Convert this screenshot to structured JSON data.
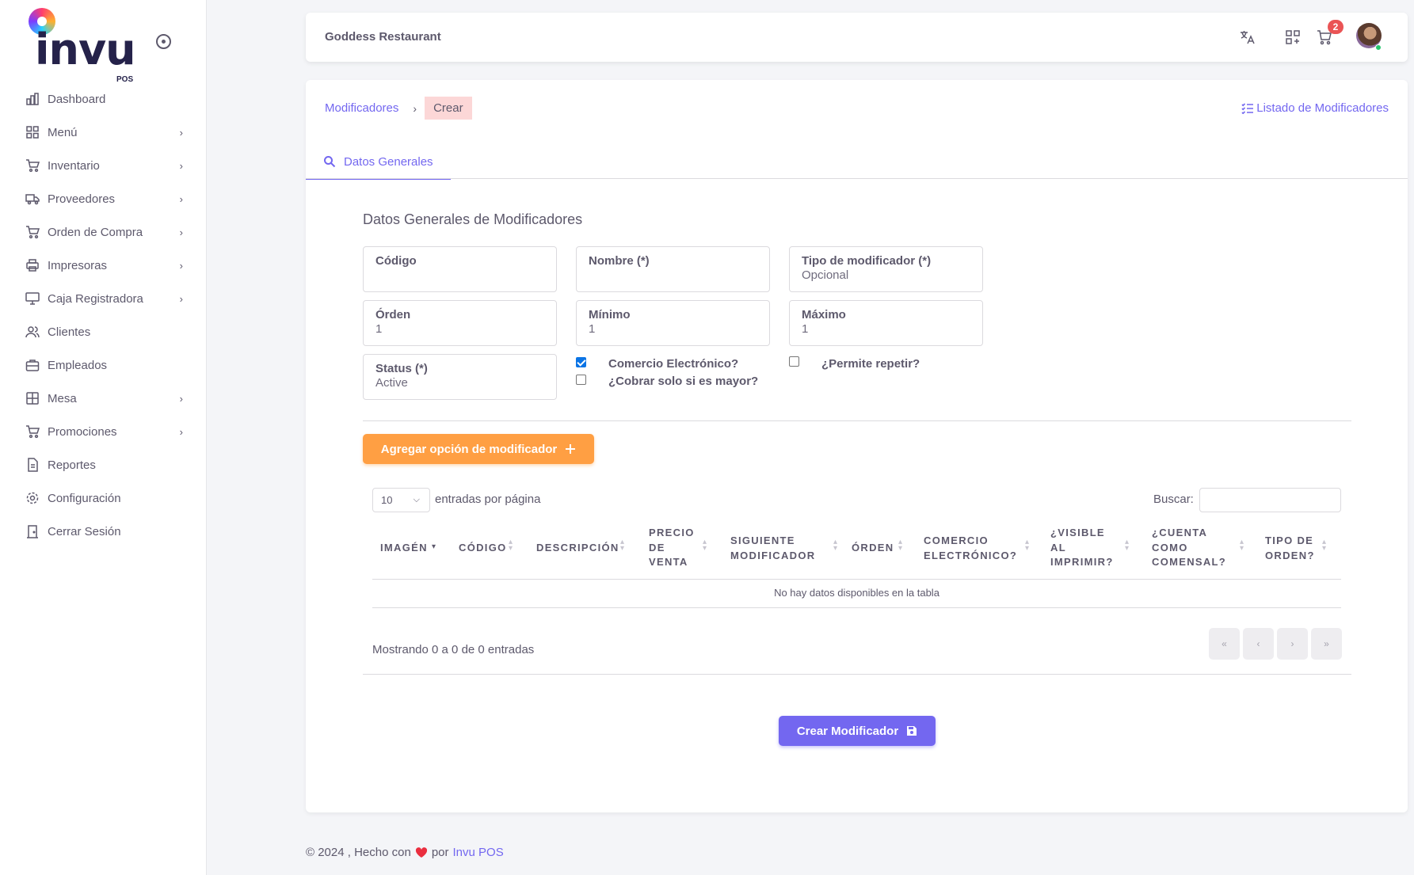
{
  "brand": {
    "word": "invu",
    "sub": "POS"
  },
  "sidebar": {
    "items": [
      {
        "label": "Dashboard",
        "icon": "chart-bar-icon",
        "chevron": false
      },
      {
        "label": "Menú",
        "icon": "grid-icon",
        "chevron": true
      },
      {
        "label": "Inventario",
        "icon": "cart-icon",
        "chevron": true
      },
      {
        "label": "Proveedores",
        "icon": "truck-icon",
        "chevron": true
      },
      {
        "label": "Orden de Compra",
        "icon": "cart-icon",
        "chevron": true
      },
      {
        "label": "Impresoras",
        "icon": "printer-icon",
        "chevron": true
      },
      {
        "label": "Caja Registradora",
        "icon": "monitor-icon",
        "chevron": true
      },
      {
        "label": "Clientes",
        "icon": "users-icon",
        "chevron": false
      },
      {
        "label": "Empleados",
        "icon": "briefcase-icon",
        "chevron": false
      },
      {
        "label": "Mesa",
        "icon": "table-icon",
        "chevron": true
      },
      {
        "label": "Promociones",
        "icon": "cart-icon",
        "chevron": true
      },
      {
        "label": "Reportes",
        "icon": "file-icon",
        "chevron": false
      },
      {
        "label": "Configuración",
        "icon": "gear-icon",
        "chevron": false
      },
      {
        "label": "Cerrar Sesión",
        "icon": "door-icon",
        "chevron": false
      }
    ]
  },
  "topbar": {
    "restaurant": "Goddess Restaurant",
    "cart_badge": "2"
  },
  "breadcrumb": {
    "parent": "Modificadores",
    "current": "Crear"
  },
  "list_link": "Listado de Modificadores",
  "tab": "Datos Generales",
  "section_title": "Datos Generales de Modificadores",
  "form": {
    "codigo": {
      "label": "Código",
      "value": ""
    },
    "nombre": {
      "label": "Nombre (*)",
      "value": ""
    },
    "tipo": {
      "label": "Tipo de modificador (*)",
      "value": "Opcional"
    },
    "orden": {
      "label": "Órden",
      "value": "1"
    },
    "minimo": {
      "label": "Mínimo",
      "value": "1"
    },
    "maximo": {
      "label": "Máximo",
      "value": "1"
    },
    "status": {
      "label": "Status (*)",
      "value": "Active"
    },
    "comercio": {
      "label": "Comercio Electrónico?",
      "checked": true
    },
    "cobrar": {
      "label": "¿Cobrar solo si es mayor?",
      "checked": false
    },
    "repetir": {
      "label": "¿Permite repetir?",
      "checked": false
    }
  },
  "add_option_button": "Agregar opción de modificador",
  "table": {
    "per_page_value": "10",
    "per_page_label": "entradas por página",
    "search_label": "Buscar:",
    "columns": [
      "IMAGÉN",
      "CÓDIGO",
      "DESCRIPCIÓN",
      "PRECIO DE VENTA",
      "SIGUIENTE MODIFICADOR",
      "ÓRDEN",
      "COMERCIO ELECTRÓNICO?",
      "¿VISIBLE AL IMPRIMIR?",
      "¿CUENTA COMO COMENSAL?",
      "TIPO DE ORDEN?"
    ],
    "empty_message": "No hay datos disponibles en la tabla",
    "showing": "Mostrando 0 a 0 de 0 entradas",
    "pagination": [
      "«",
      "‹",
      "›",
      "»"
    ]
  },
  "submit_button": "Crear Modificador",
  "footer": {
    "text": "© 2024 , Hecho con",
    "by": "por",
    "brand": "Invu POS"
  },
  "colors": {
    "primary": "#7367f0",
    "orange": "#ff9f43",
    "danger": "#ea5455",
    "success": "#28c76f"
  }
}
